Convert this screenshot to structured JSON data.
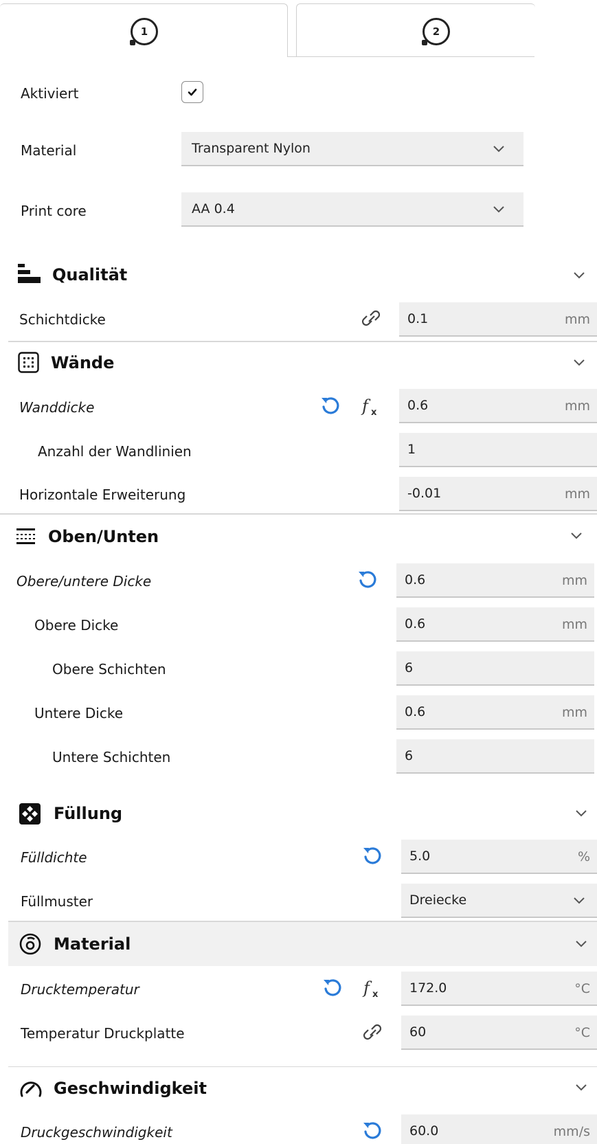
{
  "extruder_tabs": [
    {
      "number": "1",
      "active": true
    },
    {
      "number": "2",
      "active": false
    }
  ],
  "extruder": {
    "enabled_label": "Aktiviert",
    "enabled": true,
    "material_label": "Material",
    "material_value": "Transparent Nylon",
    "core_label": "Print core",
    "core_value": "AA 0.4"
  },
  "sections": {
    "quality": {
      "title": "Qualität",
      "layer_height": {
        "label": "Schichtdicke",
        "value": "0.1",
        "unit": "mm"
      }
    },
    "walls": {
      "title": "Wände",
      "wall_thickness": {
        "label": "Wanddicke",
        "value": "0.6",
        "unit": "mm"
      },
      "wall_line_count": {
        "label": "Anzahl der Wandlinien",
        "value": "1"
      },
      "horizontal_expansion": {
        "label": "Horizontale Erweiterung",
        "value": "-0.01",
        "unit": "mm"
      }
    },
    "topbottom": {
      "title": "Oben/Unten",
      "thickness": {
        "label": "Obere/untere Dicke",
        "value": "0.6",
        "unit": "mm"
      },
      "top_thickness": {
        "label": "Obere Dicke",
        "value": "0.6",
        "unit": "mm"
      },
      "top_layers": {
        "label": "Obere Schichten",
        "value": "6"
      },
      "bottom_thickness": {
        "label": "Untere Dicke",
        "value": "0.6",
        "unit": "mm"
      },
      "bottom_layers": {
        "label": "Untere Schichten",
        "value": "6"
      }
    },
    "infill": {
      "title": "Füllung",
      "density": {
        "label": "Fülldichte",
        "value": "5.0",
        "unit": "%"
      },
      "pattern": {
        "label": "Füllmuster",
        "value": "Dreiecke"
      }
    },
    "material": {
      "title": "Material",
      "print_temp": {
        "label": "Drucktemperatur",
        "value": "172.0",
        "unit": "°C"
      },
      "bed_temp": {
        "label": "Temperatur Druckplatte",
        "value": "60",
        "unit": "°C"
      }
    },
    "speed": {
      "title": "Geschwindigkeit",
      "print_speed": {
        "label": "Druckgeschwindigkeit",
        "value": "60.0",
        "unit": "mm/s"
      }
    }
  },
  "icons": {
    "reset": "reset-icon",
    "formula": "function-icon",
    "link": "link-icon",
    "chevron": "chevron-down-icon"
  },
  "colors": {
    "accent_reset": "#2a7bd8",
    "field_bg": "#efefef"
  }
}
